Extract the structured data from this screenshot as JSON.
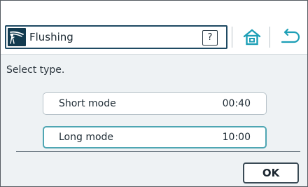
{
  "header": {
    "title": "Flushing",
    "title_icon": "flushing-icon",
    "help_label": "?",
    "home_icon": "home-icon",
    "back_icon": "back-arrow-icon"
  },
  "content": {
    "prompt": "Select type.",
    "options": [
      {
        "label": "Short mode",
        "time": "00:40",
        "selected": false
      },
      {
        "label": "Long mode",
        "time": "10:00",
        "selected": true
      }
    ],
    "ok_label": "OK"
  },
  "colors": {
    "accent": "#1d9fb6",
    "selected_border": "#4fa6b3",
    "title_border": "#1f4a63",
    "content_bg": "#eef2f4"
  }
}
